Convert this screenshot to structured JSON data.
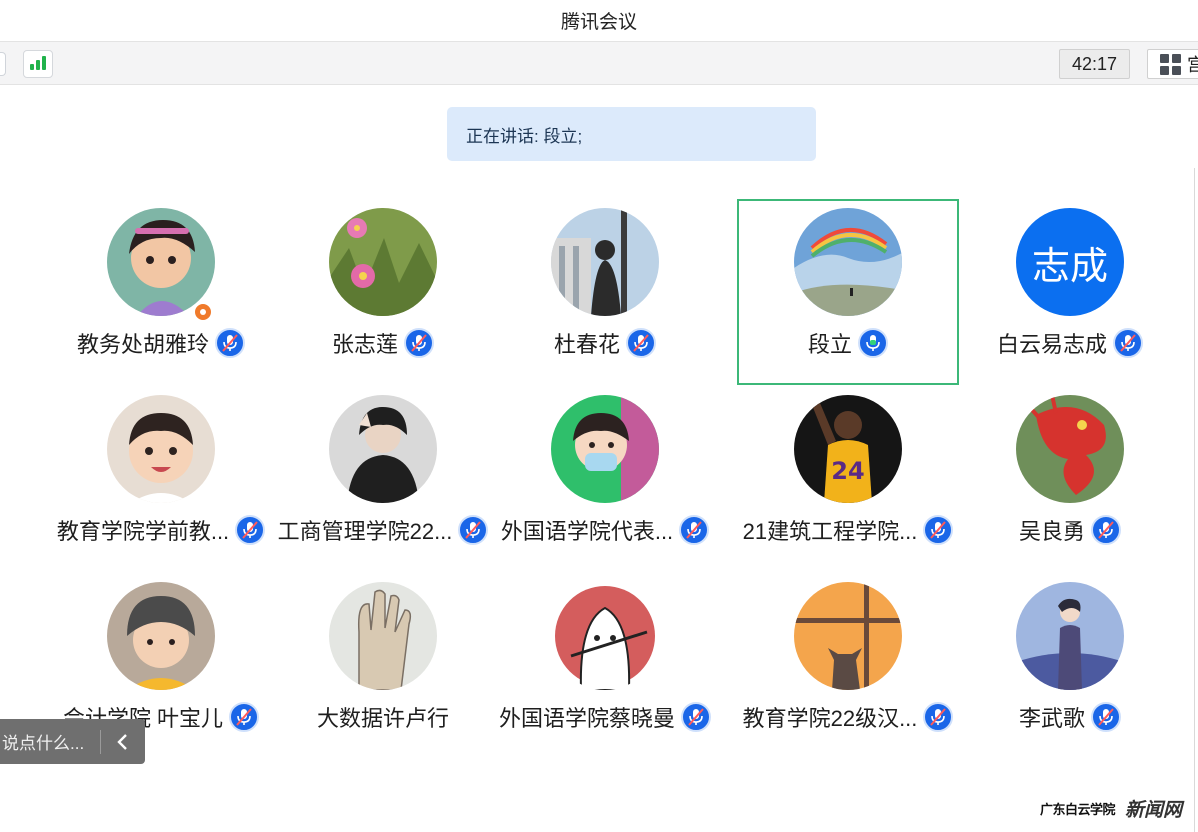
{
  "window": {
    "title": "腾讯会议"
  },
  "toolbar": {
    "signal_icon": "signal-strength-icon",
    "timer": "42:17",
    "layout_label": "宫"
  },
  "speaking": {
    "text": "正在讲话: 段立;"
  },
  "participants": [
    {
      "name": "教务处胡雅玲",
      "avatar": "photo",
      "host": true,
      "mic": "muted"
    },
    {
      "name": "张志莲",
      "avatar": "photo",
      "mic": "muted"
    },
    {
      "name": "杜春花",
      "avatar": "photo",
      "mic": "muted"
    },
    {
      "name": "段立",
      "avatar": "photo",
      "mic": "speaking",
      "active": true
    },
    {
      "name": "白云易志成",
      "avatar_text": "志成",
      "mic": "muted"
    },
    {
      "name": "教育学院学前教...",
      "avatar": "photo",
      "mic": "muted"
    },
    {
      "name": "工商管理学院22...",
      "avatar": "photo",
      "mic": "muted"
    },
    {
      "name": "外国语学院代表...",
      "avatar": "photo",
      "mic": "muted"
    },
    {
      "name": "21建筑工程学院...",
      "avatar": "photo",
      "mic": "muted"
    },
    {
      "name": "吴良勇",
      "avatar": "photo",
      "mic": "muted"
    },
    {
      "name": "会计学院 叶宝儿",
      "avatar": "photo",
      "mic": "muted"
    },
    {
      "name": "大数据许卢行",
      "avatar": "photo",
      "mic": "none"
    },
    {
      "name": "外国语学院蔡晓曼",
      "avatar": "photo",
      "mic": "muted"
    },
    {
      "name": "教育学院22级汉...",
      "avatar": "photo",
      "mic": "muted"
    },
    {
      "name": "李武歌",
      "avatar": "photo",
      "mic": "muted"
    }
  ],
  "chat": {
    "placeholder": "说点什么...",
    "collapse_icon": "chevron-left-icon"
  },
  "watermark": {
    "left": "广东白云学院",
    "right": "新闻网"
  },
  "colors": {
    "accent": "#1a66e8",
    "active_border": "#3cb878",
    "speaking_bg": "#dceafb",
    "avatar_text_bg": "#0b6ff0",
    "host_badge": "#f07a2b"
  }
}
